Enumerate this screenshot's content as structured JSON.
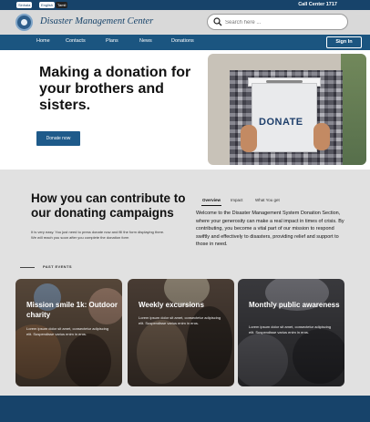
{
  "topbar": {
    "languages": [
      "Sinhala",
      "English",
      "Tamil"
    ],
    "call_center": "Call Center 1717"
  },
  "header": {
    "title": "Disaster Management Center",
    "search_placeholder": "Search here ..."
  },
  "nav": {
    "items": [
      "Home",
      "Contacts",
      "Plans",
      "News",
      "Donations"
    ],
    "signin": "Sign In"
  },
  "hero": {
    "title": "Making a donation for your brothers and sisters.",
    "button": "Donate now",
    "box_label": "DONATE"
  },
  "contribute": {
    "title": "How you can contribute to our donating campaigns",
    "subtitle": "It is very easy. You just need to press donate now and fill the form displaying there. We will reach you soon after you complete the donation form",
    "tabs": [
      "Overview",
      "Impact",
      "What You get"
    ],
    "description": "Welcome to the Disaster Management System Donation Section, where your generosity can make a real impact in times of crisis. By contributing, you become a vital part of our mission to respond swiftly and effectively to disasters, providing relief and support to those in need.",
    "past_events_label": "PAST EVENTS"
  },
  "events": [
    {
      "title": "Mission smile 1k: Outdoor charity",
      "text": "Lorem ipsum dolor sit amet, consectetur adipiscing elit. Suspendisse varius enim in eros."
    },
    {
      "title": "Weekly excursions",
      "text": "Lorem ipsum dolor sit amet, consectetur adipiscing elit. Suspendisse varius enim in eros."
    },
    {
      "title": "Monthly public awareness",
      "text": "Lorem ipsum dolor sit amet, consectetur adipiscing elit. Suspendisse varius enim in eros."
    }
  ],
  "colors": {
    "brand_dark": "#17436a",
    "nav": "#1b5580",
    "button": "#1e5a8a"
  }
}
